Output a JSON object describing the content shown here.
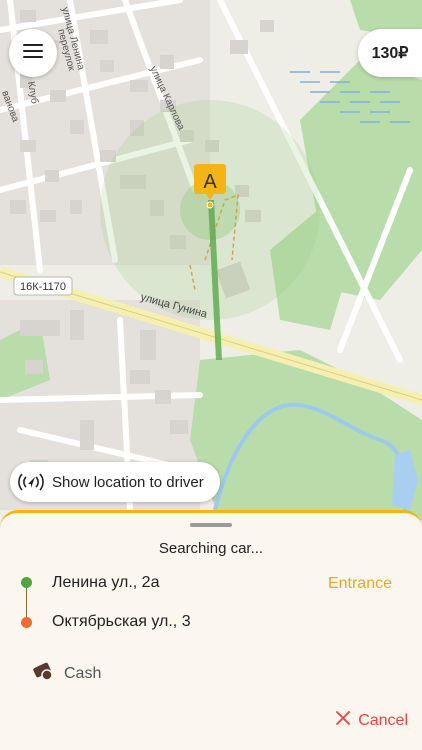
{
  "map": {
    "road_badge": "16К-1170",
    "street_labels": [
      "улица Ленина",
      "улица Карлова",
      "улица Гунина",
      "Клуб",
      "переулок",
      "ванова"
    ],
    "marker_letter": "A"
  },
  "header": {
    "menu_icon": "hamburger-menu-icon",
    "price": "130₽"
  },
  "location_button": {
    "icon": "broadcast-location-icon",
    "label": "Show location to driver"
  },
  "sheet": {
    "status": "Searching car...",
    "origin": "Ленина ул., 2а",
    "destination": "Октябрьская ул., 3",
    "entrance_label": "Entrance",
    "payment": {
      "icon": "cash-icon",
      "label": "Cash"
    },
    "cancel": {
      "icon": "close-icon",
      "label": "Cancel"
    },
    "colors": {
      "accent": "#f3b416",
      "origin": "#4fa63a",
      "destination": "#f06a35",
      "cancel": "#e8453c"
    }
  }
}
